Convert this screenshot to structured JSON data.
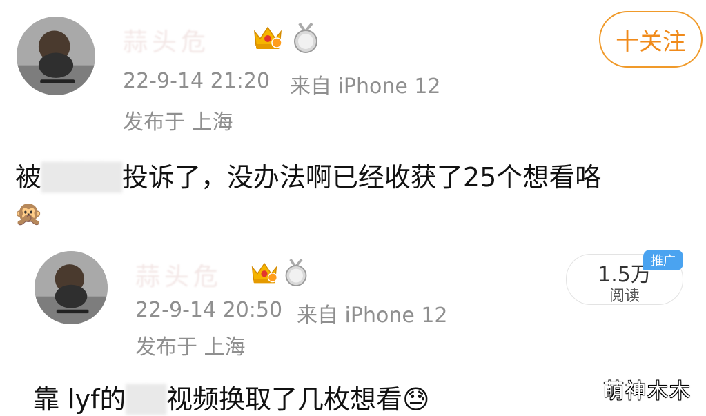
{
  "post": {
    "username": "蒜头危",
    "time": "22-9-14 21:20",
    "source": "来自 iPhone 12",
    "location": "发布于 上海",
    "follow_label": "十关注",
    "content_before": "被",
    "content_after": "投诉了，没办法啊已经收获了25个想看咯",
    "emoji": "🙊"
  },
  "quoted": {
    "username": "蒜头危",
    "time": "22-9-14 20:50",
    "source": "来自 iPhone 12",
    "location": "发布于 上海",
    "reads_value": "1.5万",
    "reads_label": "阅读",
    "promo_label": "推广",
    "content_before": "靠 lyf的",
    "content_after": "视频换取了几枚想看",
    "emoji": "😓"
  },
  "watermark": "萌神木木",
  "colors": {
    "accent_orange": "#f08a1a",
    "meta_gray": "#8f8f8f",
    "promo_blue": "#4aa3f0"
  }
}
